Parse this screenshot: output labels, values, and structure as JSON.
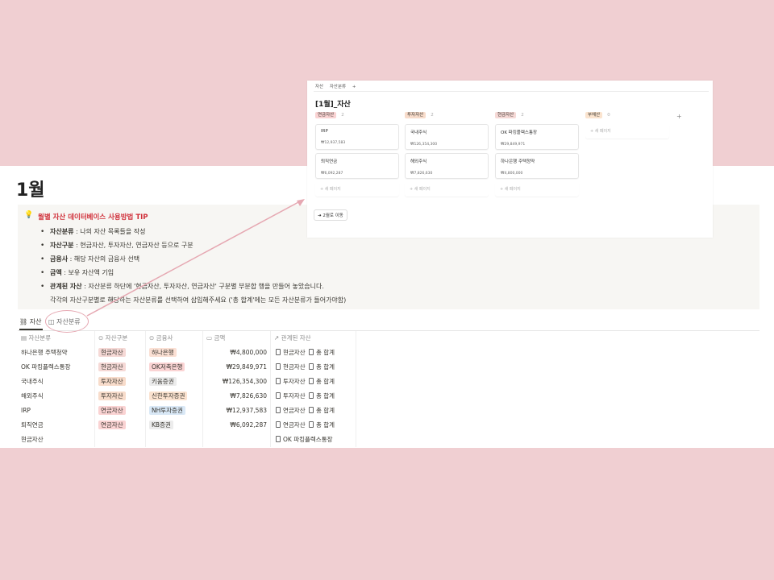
{
  "colors": {
    "cash": "#f6d9d6",
    "invest": "#f8dccb",
    "pension": "#fad3d3",
    "debt": "#fbe4cf",
    "hana": "#fbe0d4",
    "ok": "#fbd4d4",
    "kiwoom": "#ececec",
    "shinhan": "#fbe2cf",
    "nh": "#d9e8f6",
    "kb": "#ececec"
  },
  "page": {
    "title": "1월"
  },
  "tip": {
    "title": "월별 자산 데이터베이스 사용방법 TIP",
    "items": [
      {
        "label": "자산분류",
        "text": " : 나의 자산 목록들을 작성"
      },
      {
        "label": "자산구분",
        "text": " : 현금자산, 투자자산, 연금자산 등으로 구분"
      },
      {
        "label": "금융사",
        "text": " : 해당 자산의 금융사 선택"
      },
      {
        "label": "금액",
        "text": " : 보유 자산액 기입"
      },
      {
        "label": "관계된 자산",
        "text": " : 자산분류 하단에 '현금자산, 투자자산, 연금자산' 구분별 부분합 행을 만들어 놓았습니다."
      }
    ],
    "extra": "각각의 자산구분별로 해당하는 자산분류를 선택하여 삽입해주세요 ('총 합계'에는 모든 자산분류가 들어가야함)"
  },
  "tabs": {
    "asset": "자산",
    "category": "자산분류"
  },
  "table": {
    "headers": [
      "자산분류",
      "자산구분",
      "금융사",
      "금액",
      "관계된 자산"
    ],
    "rows": [
      {
        "name": "하나은행 주택청약",
        "type": "현금자산",
        "company": "하나은행",
        "amount": "₩4,800,000",
        "rel1": "현금자산",
        "rel2": "총 합계"
      },
      {
        "name": "OK 파킹플렉스통장",
        "type": "현금자산",
        "company": "OK저축은행",
        "amount": "₩29,849,971",
        "rel1": "현금자산",
        "rel2": "총 합계"
      },
      {
        "name": "국내주식",
        "type": "투자자산",
        "company": "키움증권",
        "amount": "₩126,354,300",
        "rel1": "투자자산",
        "rel2": "총 합계"
      },
      {
        "name": "해외주식",
        "type": "투자자산",
        "company": "신한투자증권",
        "amount": "₩7,826,630",
        "rel1": "투자자산",
        "rel2": "총 합계"
      },
      {
        "name": "IRP",
        "type": "연금자산",
        "company": "NH투자증권",
        "amount": "₩12,937,583",
        "rel1": "연금자산",
        "rel2": "총 합계"
      },
      {
        "name": "퇴직연금",
        "type": "연금자산",
        "company": "KB증권",
        "amount": "₩6,092,287",
        "rel1": "연금자산",
        "rel2": "총 합계"
      },
      {
        "name": "현금자산",
        "type": "",
        "company": "",
        "amount": "",
        "rel1": "OK 파킹플렉스통장",
        "rel2": ""
      }
    ]
  },
  "board": {
    "tabs": [
      "자산",
      "자산분류",
      "+"
    ],
    "title": "[1월]_자산",
    "new_page": "+ 새 페이지",
    "add_group": "+",
    "button": "2월로 이동",
    "columns": [
      {
        "name": "연금자산",
        "count": "2",
        "cards": [
          {
            "name": "IRP",
            "amount": "₩12,937,583"
          },
          {
            "name": "퇴직연금",
            "amount": "₩6,092,287"
          }
        ]
      },
      {
        "name": "투자자산",
        "count": "2",
        "cards": [
          {
            "name": "국내주식",
            "amount": "₩126,354,300"
          },
          {
            "name": "해외주식",
            "amount": "₩7,826,630"
          }
        ]
      },
      {
        "name": "현금자산",
        "count": "2",
        "cards": [
          {
            "name": "OK 파킹플렉스통장",
            "amount": "₩29,849,971"
          },
          {
            "name": "하나은행 주택청약",
            "amount": "₩4,800,000"
          }
        ]
      },
      {
        "name": "부채산",
        "count": "0",
        "cards": []
      }
    ]
  }
}
